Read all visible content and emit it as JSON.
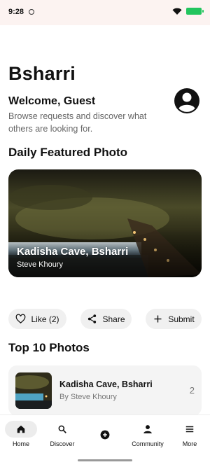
{
  "status_bar": {
    "time": "9:28"
  },
  "page": {
    "title": "Bsharri"
  },
  "welcome": {
    "heading": "Welcome, Guest",
    "subtitle": "Browse requests and discover what others are looking for."
  },
  "featured": {
    "section_title": "Daily Featured Photo",
    "photo_title": "Kadisha Cave, Bsharri",
    "author": "Steve Khoury"
  },
  "actions": {
    "like_label": "Like (2)",
    "share_label": "Share",
    "submit_label": "Submit"
  },
  "top_photos": {
    "section_title": "Top 10 Photos",
    "items": [
      {
        "title": "Kadisha Cave, Bsharri",
        "author": "By Steve Khoury",
        "rank": "2"
      }
    ]
  },
  "nav": {
    "items": [
      {
        "label": "Home",
        "icon": "home-icon",
        "active": true
      },
      {
        "label": "Discover",
        "icon": "search-icon"
      },
      {
        "label": "",
        "icon": "add-circle-icon"
      },
      {
        "label": "Community",
        "icon": "person-icon"
      },
      {
        "label": "More",
        "icon": "menu-icon"
      }
    ]
  },
  "colors": {
    "battery": "#22c55e",
    "status_bg": "#fcf3f1",
    "pill_bg": "#f0f0f0",
    "card_bg": "#f4f4f4"
  }
}
